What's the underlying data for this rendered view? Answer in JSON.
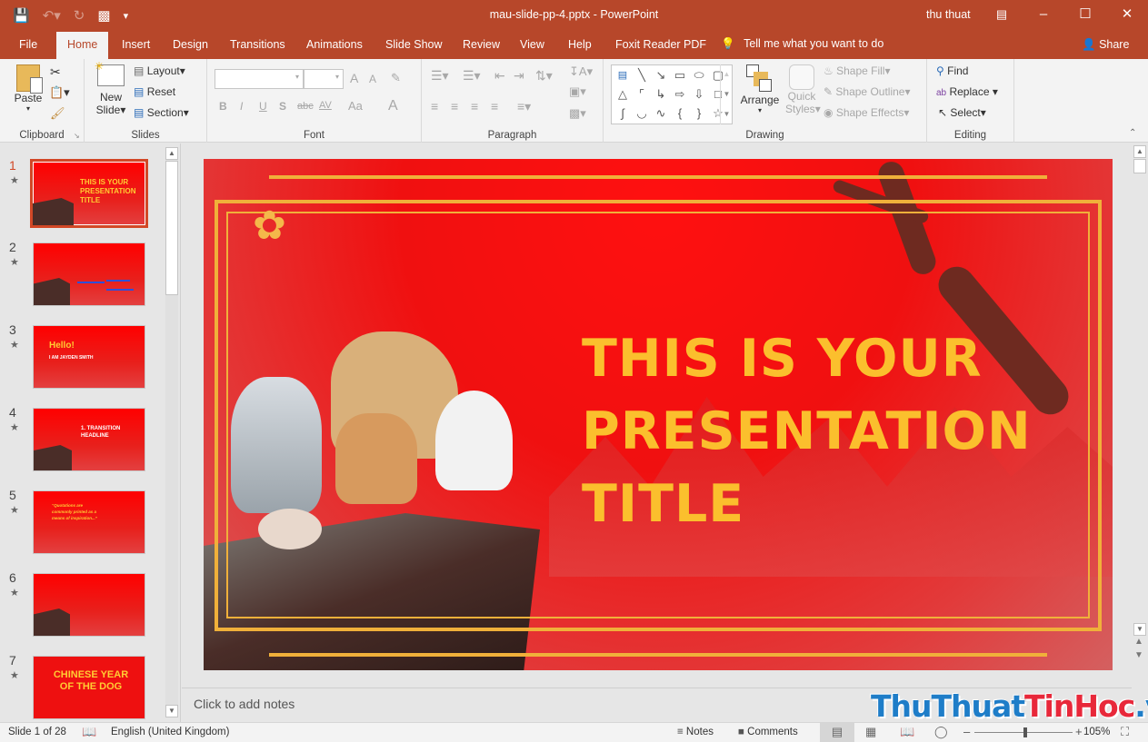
{
  "window": {
    "title": "mau-slide-pp-4.pptx  -  PowerPoint",
    "user": "thu thuat"
  },
  "quick_access": [
    "save-icon",
    "undo-icon",
    "redo-icon",
    "start-from-beginning-icon",
    "customize-icon"
  ],
  "tabs": [
    {
      "label": "File"
    },
    {
      "label": "Home",
      "active": true
    },
    {
      "label": "Insert"
    },
    {
      "label": "Design"
    },
    {
      "label": "Transitions"
    },
    {
      "label": "Animations"
    },
    {
      "label": "Slide Show"
    },
    {
      "label": "Review"
    },
    {
      "label": "View"
    },
    {
      "label": "Help"
    },
    {
      "label": "Foxit Reader PDF"
    }
  ],
  "tell_me": "Tell me what you want to do",
  "share": "Share",
  "ribbon": {
    "clipboard": {
      "label": "Clipboard",
      "paste": "Paste"
    },
    "slides": {
      "label": "Slides",
      "new_slide_1": "New",
      "new_slide_2": "Slide",
      "layout": "Layout",
      "reset": "Reset",
      "section": "Section"
    },
    "font": {
      "label": "Font",
      "font_name": "",
      "font_size": "",
      "bold": "B",
      "italic": "I",
      "underline": "U",
      "shadow": "S",
      "strike": "abc",
      "spacing": "AV",
      "case": "Aa",
      "color": "A",
      "grow": "A",
      "shrink": "A"
    },
    "paragraph": {
      "label": "Paragraph"
    },
    "drawing": {
      "label": "Drawing",
      "arrange": "Arrange",
      "quick_styles_1": "Quick",
      "quick_styles_2": "Styles",
      "shape_fill": "Shape Fill",
      "shape_outline": "Shape Outline",
      "shape_effects": "Shape Effects"
    },
    "editing": {
      "label": "Editing",
      "find": "Find",
      "replace": "Replace",
      "select": "Select"
    }
  },
  "slides": [
    {
      "num": "1",
      "title": "THIS IS YOUR PRESENTATION TITLE",
      "selected": true
    },
    {
      "num": "2",
      "title": ""
    },
    {
      "num": "3",
      "title": "Hello!",
      "subtitle": "I AM JAYDEN SMITH"
    },
    {
      "num": "4",
      "title": "1. TRANSITION HEADLINE"
    },
    {
      "num": "5",
      "title": "“Quotations are commonly printed as a means of inspiration...”"
    },
    {
      "num": "6",
      "title": ""
    },
    {
      "num": "7",
      "title": "CHINESE YEAR OF THE DOG"
    }
  ],
  "main_slide": {
    "title_lines": [
      "THIS IS YOUR",
      "PRESENTATION",
      "TITLE"
    ],
    "title_color": "#fbbf2d",
    "bg_color": "#f01010"
  },
  "notes_placeholder": "Click to add notes",
  "status": {
    "slide_counter": "Slide 1 of 28",
    "language": "English (United Kingdom)",
    "notes": "Notes",
    "comments": "Comments",
    "zoom": "105%",
    "zoom_fraction": 0.52
  },
  "watermark": {
    "part1": "ThuThuat",
    "part2": "TinHoc",
    ".vn": ".vn"
  },
  "colors": {
    "accent": "#b7472a",
    "selected_thumb": "#d24726"
  }
}
